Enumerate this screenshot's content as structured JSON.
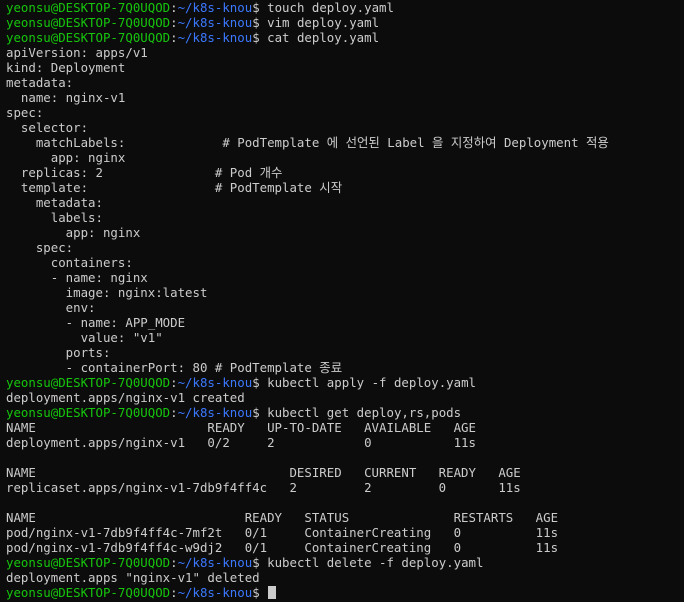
{
  "colors": {
    "background": "#0c0c0c",
    "text": "#cccccc",
    "prompt_user": "#16c60c",
    "prompt_path": "#3b78ff",
    "cursor": "#cccccc"
  },
  "prompt": {
    "user_host": "yeonsu@DESKTOP-7Q0UQOD",
    "colon": ":",
    "path": "~/k8s-knou",
    "symbol": "$"
  },
  "lines": [
    {
      "kind": "cmd",
      "text": " touch deploy.yaml"
    },
    {
      "kind": "cmd",
      "text": " vim deploy.yaml"
    },
    {
      "kind": "cmd",
      "text": " cat deploy.yaml"
    },
    {
      "kind": "out",
      "text": "apiVersion: apps/v1"
    },
    {
      "kind": "out",
      "text": "kind: Deployment"
    },
    {
      "kind": "out",
      "text": "metadata:"
    },
    {
      "kind": "out",
      "text": "  name: nginx-v1"
    },
    {
      "kind": "out",
      "text": "spec:"
    },
    {
      "kind": "out",
      "text": "  selector:"
    },
    {
      "kind": "out",
      "text": "    matchLabels:             # PodTemplate 에 선언된 Label 을 지정하여 Deployment 적용"
    },
    {
      "kind": "out",
      "text": "      app: nginx"
    },
    {
      "kind": "out",
      "text": "  replicas: 2               # Pod 개수"
    },
    {
      "kind": "out",
      "text": "  template:                 # PodTemplate 시작"
    },
    {
      "kind": "out",
      "text": "    metadata:"
    },
    {
      "kind": "out",
      "text": "      labels:"
    },
    {
      "kind": "out",
      "text": "        app: nginx"
    },
    {
      "kind": "out",
      "text": "    spec:"
    },
    {
      "kind": "out",
      "text": "      containers:"
    },
    {
      "kind": "out",
      "text": "      - name: nginx"
    },
    {
      "kind": "out",
      "text": "        image: nginx:latest"
    },
    {
      "kind": "out",
      "text": "        env:"
    },
    {
      "kind": "out",
      "text": "        - name: APP_MODE"
    },
    {
      "kind": "out",
      "text": "          value: \"v1\""
    },
    {
      "kind": "out",
      "text": "        ports:"
    },
    {
      "kind": "out",
      "text": "        - containerPort: 80 # PodTemplate 종료"
    },
    {
      "kind": "cmd",
      "text": " kubectl apply -f deploy.yaml"
    },
    {
      "kind": "out",
      "text": "deployment.apps/nginx-v1 created"
    },
    {
      "kind": "cmd",
      "text": " kubectl get deploy,rs,pods"
    },
    {
      "kind": "out",
      "text": "NAME                       READY   UP-TO-DATE   AVAILABLE   AGE"
    },
    {
      "kind": "out",
      "text": "deployment.apps/nginx-v1   0/2     2            0           11s"
    },
    {
      "kind": "out",
      "text": ""
    },
    {
      "kind": "out",
      "text": "NAME                                  DESIRED   CURRENT   READY   AGE"
    },
    {
      "kind": "out",
      "text": "replicaset.apps/nginx-v1-7db9f4ff4c   2         2         0       11s"
    },
    {
      "kind": "out",
      "text": ""
    },
    {
      "kind": "out",
      "text": "NAME                            READY   STATUS              RESTARTS   AGE"
    },
    {
      "kind": "out",
      "text": "pod/nginx-v1-7db9f4ff4c-7mf2t   0/1     ContainerCreating   0          11s"
    },
    {
      "kind": "out",
      "text": "pod/nginx-v1-7db9f4ff4c-w9dj2   0/1     ContainerCreating   0          11s"
    },
    {
      "kind": "cmd",
      "text": " kubectl delete -f deploy.yaml"
    },
    {
      "kind": "out",
      "text": "deployment.apps \"nginx-v1\" deleted"
    },
    {
      "kind": "prompt",
      "text": " "
    }
  ]
}
